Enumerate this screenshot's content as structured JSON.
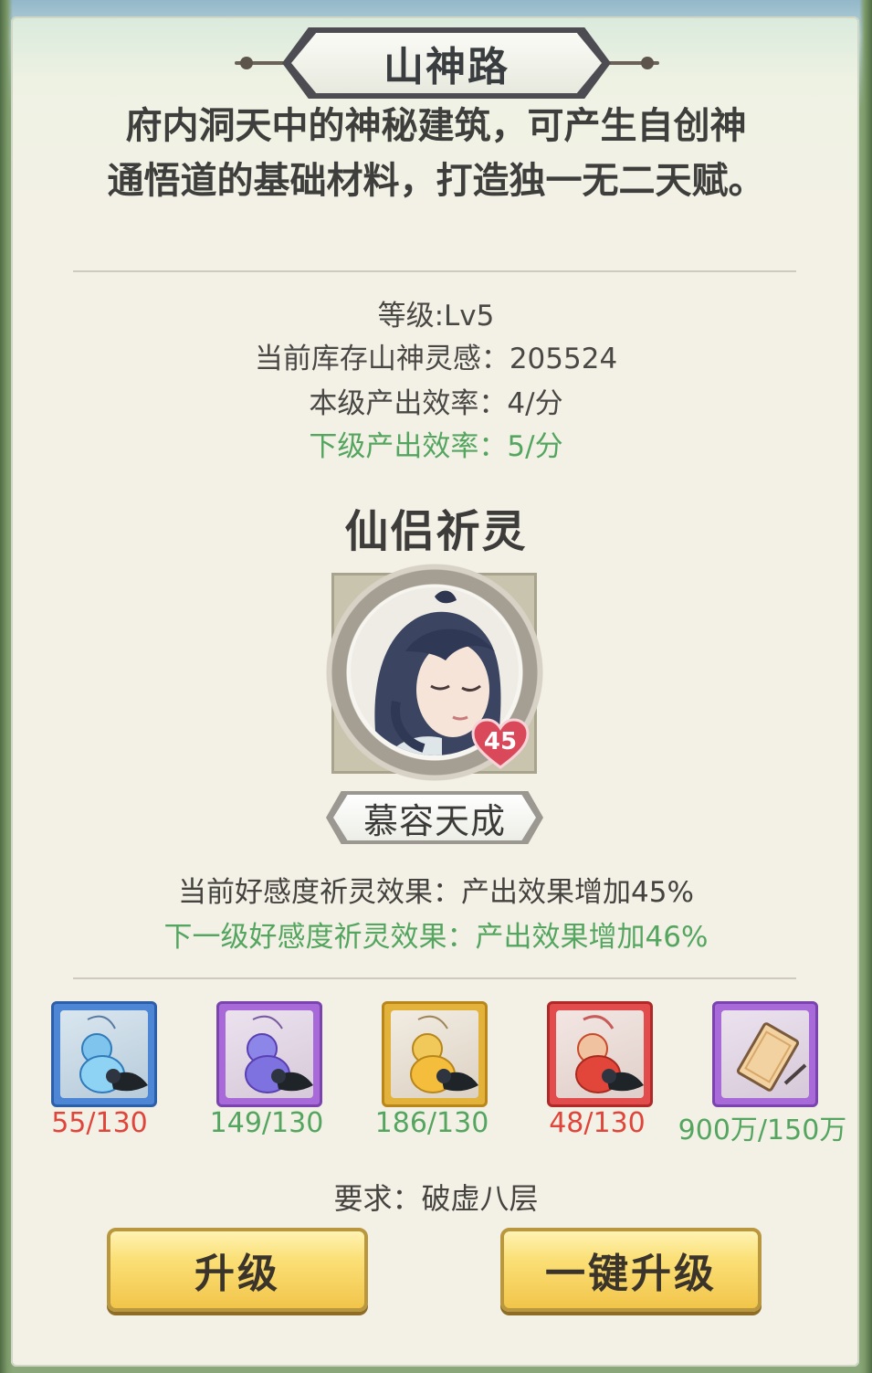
{
  "header": {
    "title": "山神路"
  },
  "description": {
    "line1": "府内洞天中的神秘建筑，可产生自创神",
    "line2": "通悟道的基础材料，打造独一无二天赋。"
  },
  "stats": {
    "level": "等级:Lv5",
    "stock": "当前库存山神灵感：205524",
    "current_rate": "本级产出效率：4/分",
    "next_rate": "下级产出效率：5/分"
  },
  "blessing": {
    "title": "仙侣祈灵",
    "partner_name": "慕容天成",
    "affection_level": "45",
    "current_effect": "当前好感度祈灵效果：产出效果增加45%",
    "next_effect": "下一级好感度祈灵效果：产出效果增加46%"
  },
  "materials": [
    {
      "icon": "blue-gourd-icon",
      "count": "55/130",
      "status": "insufficient"
    },
    {
      "icon": "purple-gourd-icon",
      "count": "149/130",
      "status": "sufficient"
    },
    {
      "icon": "gold-gourd-icon",
      "count": "186/130",
      "status": "sufficient"
    },
    {
      "icon": "red-gourd-icon",
      "count": "48/130",
      "status": "insufficient"
    },
    {
      "icon": "silver-note-icon",
      "count": "900万/150万",
      "status": "sufficient"
    }
  ],
  "requirement": "要求：破虚八层",
  "buttons": {
    "upgrade": "升级",
    "one_click_upgrade": "一键升级"
  },
  "colors": {
    "insufficient": "#e0453b",
    "sufficient": "#54a55f",
    "button_gold": "#f2c54a"
  }
}
